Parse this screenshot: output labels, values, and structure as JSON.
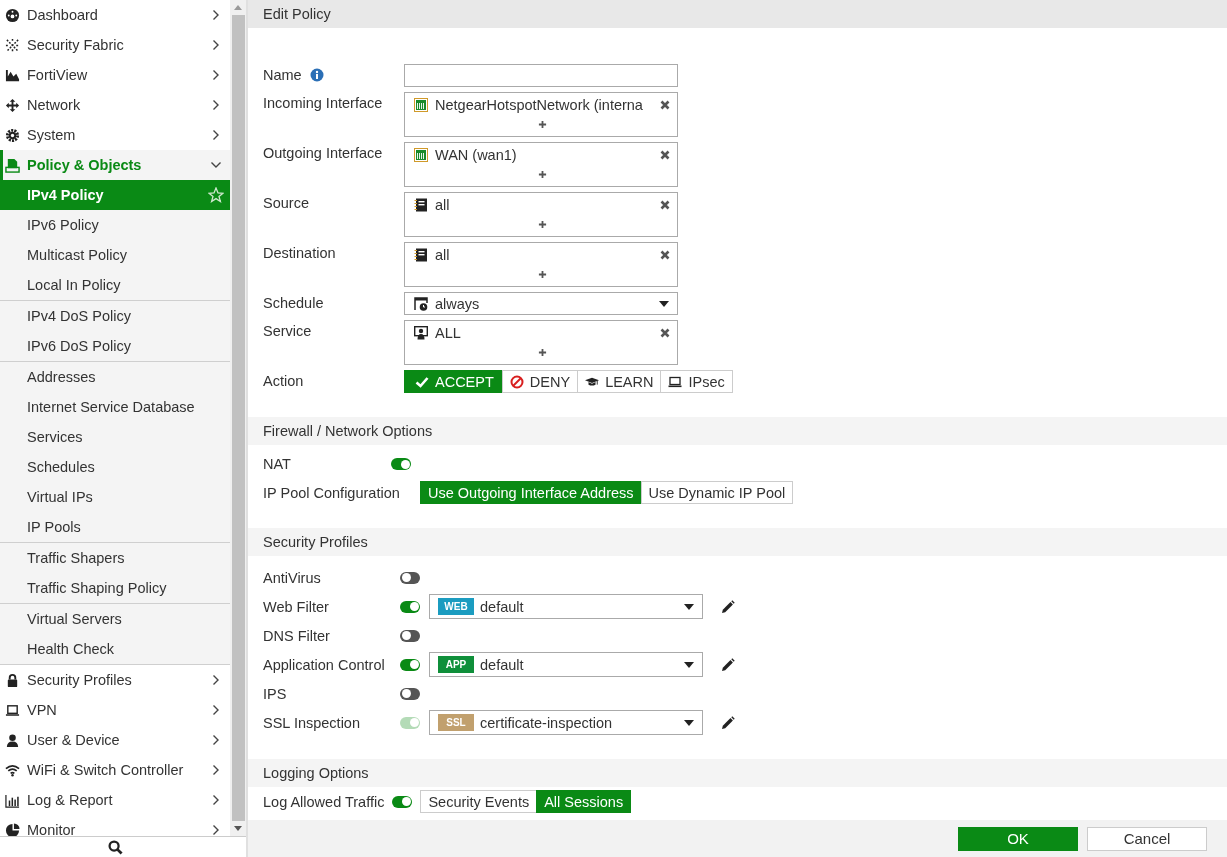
{
  "sidebar": {
    "items": [
      {
        "label": "Dashboard",
        "expanded": false,
        "active": false
      },
      {
        "label": "Security Fabric",
        "expanded": false,
        "active": false
      },
      {
        "label": "FortiView",
        "expanded": false,
        "active": false
      },
      {
        "label": "Network",
        "expanded": false,
        "active": false
      },
      {
        "label": "System",
        "expanded": false,
        "active": false
      },
      {
        "label": "Policy & Objects",
        "expanded": true,
        "active": true,
        "groups": [
          {
            "items": [
              {
                "label": "IPv4 Policy",
                "selected": true
              },
              {
                "label": "IPv6 Policy",
                "selected": false
              },
              {
                "label": "Multicast Policy",
                "selected": false
              },
              {
                "label": "Local In Policy",
                "selected": false
              }
            ]
          },
          {
            "items": [
              {
                "label": "IPv4 DoS Policy",
                "selected": false
              },
              {
                "label": "IPv6 DoS Policy",
                "selected": false
              }
            ]
          },
          {
            "items": [
              {
                "label": "Addresses",
                "selected": false
              },
              {
                "label": "Internet Service Database",
                "selected": false
              },
              {
                "label": "Services",
                "selected": false
              },
              {
                "label": "Schedules",
                "selected": false
              },
              {
                "label": "Virtual IPs",
                "selected": false
              },
              {
                "label": "IP Pools",
                "selected": false
              }
            ]
          },
          {
            "items": [
              {
                "label": "Traffic Shapers",
                "selected": false
              },
              {
                "label": "Traffic Shaping Policy",
                "selected": false
              }
            ]
          },
          {
            "items": [
              {
                "label": "Virtual Servers",
                "selected": false
              },
              {
                "label": "Health Check",
                "selected": false
              }
            ]
          }
        ]
      },
      {
        "label": "Security Profiles",
        "expanded": false,
        "active": false
      },
      {
        "label": "VPN",
        "expanded": false,
        "active": false
      },
      {
        "label": "User & Device",
        "expanded": false,
        "active": false
      },
      {
        "label": "WiFi & Switch Controller",
        "expanded": false,
        "active": false
      },
      {
        "label": "Log & Report",
        "expanded": false,
        "active": false
      },
      {
        "label": "Monitor",
        "expanded": false,
        "active": false
      }
    ]
  },
  "page_title": "Edit Policy",
  "policy_fields": [
    {
      "label": "Name",
      "kind": "text"
    },
    {
      "label": "Incoming Interface",
      "kind": "multi",
      "entries": [
        {
          "label": "NetgearHotspotNetwork (interna",
          "kind": "interface"
        }
      ]
    },
    {
      "label": "Outgoing Interface",
      "kind": "multi",
      "entries": [
        {
          "label": "WAN (wan1)",
          "kind": "interface"
        }
      ]
    },
    {
      "label": "Source",
      "kind": "multi",
      "entries": [
        {
          "label": "all",
          "kind": "address"
        }
      ]
    },
    {
      "label": "Destination",
      "kind": "multi",
      "entries": [
        {
          "label": "all",
          "kind": "address"
        }
      ]
    },
    {
      "label": "Schedule",
      "kind": "select",
      "value": "always"
    },
    {
      "label": "Service",
      "kind": "multi",
      "entries": [
        {
          "label": "ALL",
          "kind": "service"
        }
      ]
    },
    {
      "label": "Action",
      "kind": "buttons",
      "options": [
        {
          "label": "ACCEPT",
          "kind": "accept",
          "selected": true
        },
        {
          "label": "DENY",
          "kind": "deny",
          "selected": false
        },
        {
          "label": "LEARN",
          "kind": "learn",
          "selected": false
        },
        {
          "label": "IPsec",
          "kind": "ipsec",
          "selected": false
        }
      ]
    }
  ],
  "firewall": {
    "title": "Firewall / Network Options",
    "nat": {
      "label": "NAT",
      "on": true
    },
    "ip_pool": {
      "label": "IP Pool Configuration",
      "options": [
        {
          "label": "Use Outgoing Interface Address",
          "selected": true
        },
        {
          "label": "Use Dynamic IP Pool",
          "selected": false
        }
      ]
    }
  },
  "security_profiles": {
    "title": "Security Profiles",
    "rows": [
      {
        "label": "AntiVirus",
        "on": false,
        "disabled": false
      },
      {
        "label": "Web Filter",
        "on": true,
        "disabled": false,
        "profile": {
          "tag": "WEB",
          "color": "#1b9cc0",
          "value": "default"
        }
      },
      {
        "label": "DNS Filter",
        "on": false,
        "disabled": false
      },
      {
        "label": "Application Control",
        "on": true,
        "disabled": false,
        "profile": {
          "tag": "APP",
          "color": "#0f8f3a",
          "value": "default"
        }
      },
      {
        "label": "IPS",
        "on": false,
        "disabled": false
      },
      {
        "label": "SSL Inspection",
        "on": true,
        "disabled": true,
        "profile": {
          "tag": "SSL",
          "color": "#c1a06e",
          "value": "certificate-inspection"
        }
      }
    ]
  },
  "logging": {
    "title": "Logging Options",
    "label": "Log Allowed Traffic",
    "on": true,
    "options": [
      {
        "label": "Security Events",
        "selected": false
      },
      {
        "label": "All Sessions",
        "selected": true
      }
    ]
  },
  "footer_buttons": [
    {
      "label": "OK",
      "kind": "primary"
    },
    {
      "label": "Cancel",
      "kind": "secondary"
    }
  ]
}
